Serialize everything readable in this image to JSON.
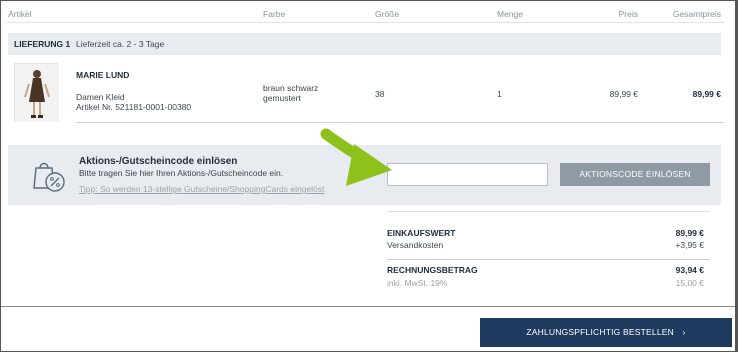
{
  "table_header": {
    "artikel": "Artikel",
    "farbe": "Farbe",
    "groesse": "Größe",
    "menge": "Menge",
    "preis": "Preis",
    "gesamtpreis": "Gesamtpreis"
  },
  "delivery": {
    "title": "LIEFERUNG 1",
    "time": "Lieferzeit ca. 2 - 3 Tage"
  },
  "product": {
    "name": "MARIE LUND",
    "type": "Damen Kleid",
    "article_no": "Artikel Nr. 521181-0001-00380",
    "color": "braun schwarz gemustert",
    "size": "38",
    "quantity": "1",
    "price": "89,99 €",
    "total": "89,99 €"
  },
  "coupon": {
    "title": "Aktions-/Gutscheincode einlösen",
    "subtitle": "Bitte tragen Sie hier Ihren Aktions-/Gutscheincode ein.",
    "tip": "Tipp: So werden 13-stellige Gutscheine/ShoppingCards eingelöst",
    "input_placeholder": "",
    "button_label": "AKTIONSCODE EINLÖSEN",
    "icon": "shopping-bag-percent-icon"
  },
  "summary": {
    "einkaufswert_label": "EINKAUFSWERT",
    "einkaufswert_value": "89,99 €",
    "versand_label": "Versandkosten",
    "versand_value": "+3,95 €",
    "rechnung_label": "RECHNUNGSBETRAG",
    "rechnung_value": "93,94 €",
    "mwst_label": "inkl. MwSt. 19%",
    "mwst_value": "15,00 €"
  },
  "checkout": {
    "button_label": "ZAHLUNGSPFLICHTIG BESTELLEN",
    "chevron": "›"
  },
  "colors": {
    "primary": "#1f3a5f",
    "panel": "#e8ecf0",
    "disabled_button": "#8f9aa5",
    "arrow": "#8ec11c"
  }
}
